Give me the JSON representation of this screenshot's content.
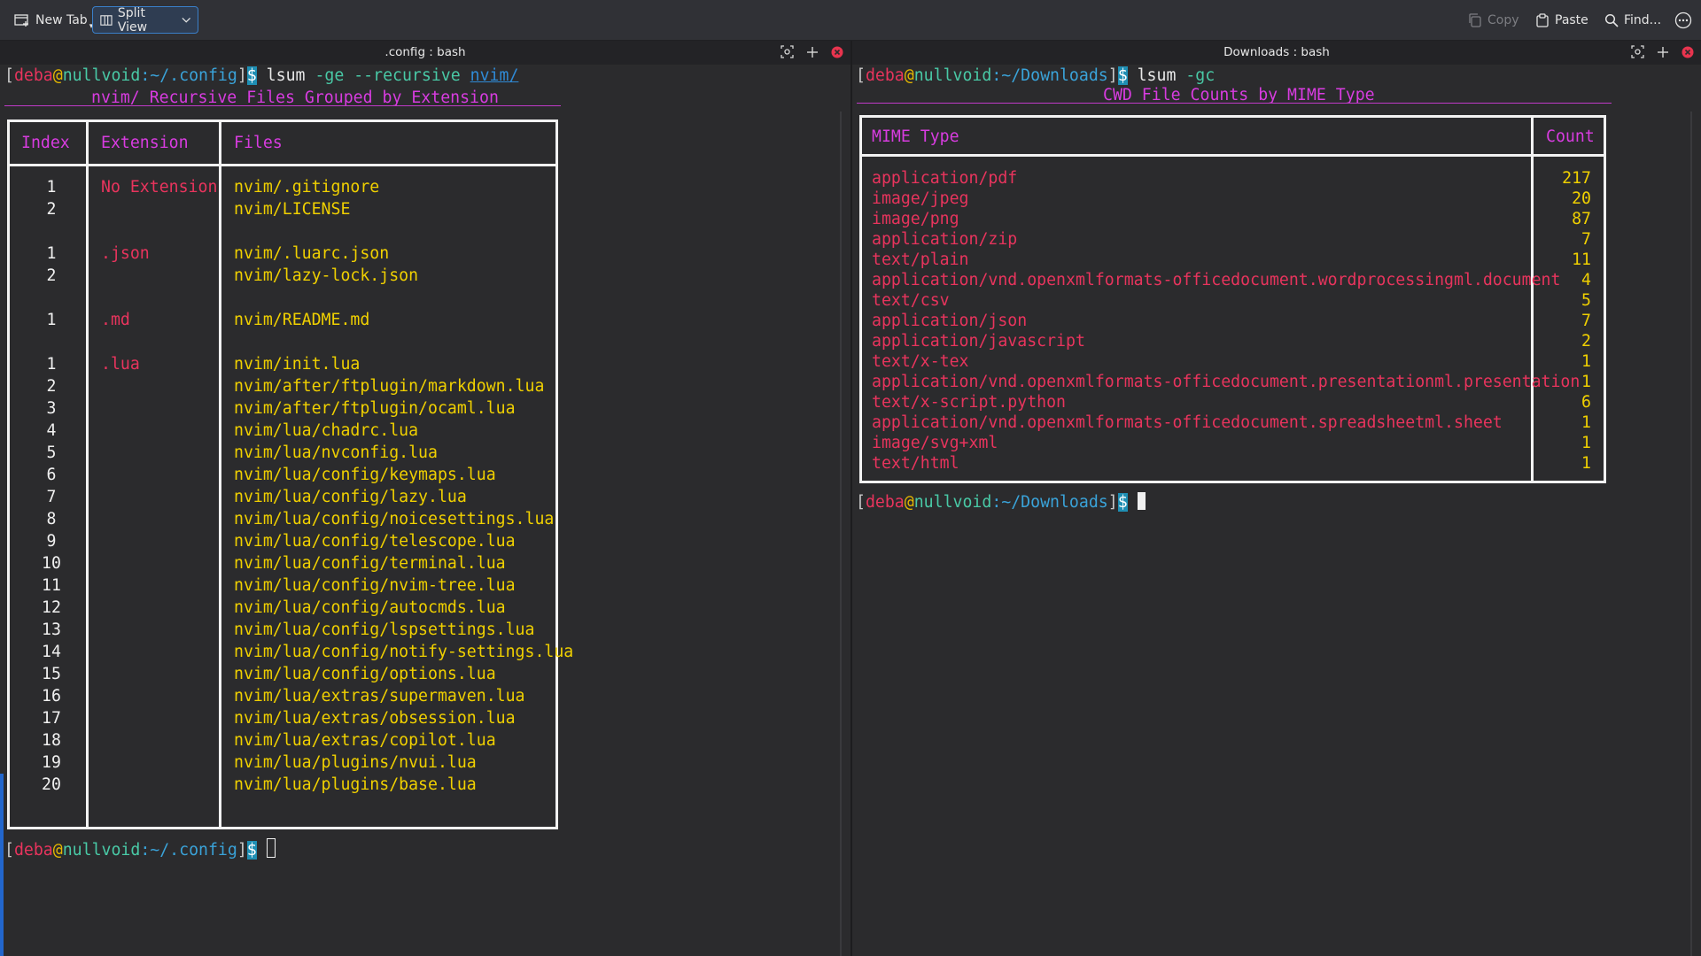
{
  "toolbar": {
    "new_tab": "New Tab",
    "split_view": "Split View",
    "copy": "Copy",
    "paste": "Paste",
    "find": "Find..."
  },
  "left": {
    "title": ".config : bash",
    "prompt": {
      "user": "deba",
      "at": "@",
      "host": "nullvoid",
      "path": ":~/.config",
      "dollar": "$"
    },
    "command": {
      "cmd": " lsum ",
      "flags": "-ge --recursive ",
      "arg": "nvim/"
    },
    "table_title": "nvim/ Recursive Files Grouped by Extension",
    "headers": {
      "index": "Index",
      "extension": "Extension",
      "files": "Files"
    },
    "rows": [
      {
        "index": "1",
        "ext": "No Extension",
        "file": "nvim/.gitignore"
      },
      {
        "index": "2",
        "ext": "",
        "file": "nvim/LICENSE"
      },
      {
        "index": "1",
        "ext": ".json",
        "file": "nvim/.luarc.json"
      },
      {
        "index": "2",
        "ext": "",
        "file": "nvim/lazy-lock.json"
      },
      {
        "index": "1",
        "ext": ".md",
        "file": "nvim/README.md"
      },
      {
        "index": "1",
        "ext": ".lua",
        "file": "nvim/init.lua"
      },
      {
        "index": "2",
        "ext": "",
        "file": "nvim/after/ftplugin/markdown.lua"
      },
      {
        "index": "3",
        "ext": "",
        "file": "nvim/after/ftplugin/ocaml.lua"
      },
      {
        "index": "4",
        "ext": "",
        "file": "nvim/lua/chadrc.lua"
      },
      {
        "index": "5",
        "ext": "",
        "file": "nvim/lua/nvconfig.lua"
      },
      {
        "index": "6",
        "ext": "",
        "file": "nvim/lua/config/keymaps.lua"
      },
      {
        "index": "7",
        "ext": "",
        "file": "nvim/lua/config/lazy.lua"
      },
      {
        "index": "8",
        "ext": "",
        "file": "nvim/lua/config/noicesettings.lua"
      },
      {
        "index": "9",
        "ext": "",
        "file": "nvim/lua/config/telescope.lua"
      },
      {
        "index": "10",
        "ext": "",
        "file": "nvim/lua/config/terminal.lua"
      },
      {
        "index": "11",
        "ext": "",
        "file": "nvim/lua/config/nvim-tree.lua"
      },
      {
        "index": "12",
        "ext": "",
        "file": "nvim/lua/config/autocmds.lua"
      },
      {
        "index": "13",
        "ext": "",
        "file": "nvim/lua/config/lspsettings.lua"
      },
      {
        "index": "14",
        "ext": "",
        "file": "nvim/lua/config/notify-settings.lua"
      },
      {
        "index": "15",
        "ext": "",
        "file": "nvim/lua/config/options.lua"
      },
      {
        "index": "16",
        "ext": "",
        "file": "nvim/lua/extras/supermaven.lua"
      },
      {
        "index": "17",
        "ext": "",
        "file": "nvim/lua/extras/obsession.lua"
      },
      {
        "index": "18",
        "ext": "",
        "file": "nvim/lua/extras/copilot.lua"
      },
      {
        "index": "19",
        "ext": "",
        "file": "nvim/lua/plugins/nvui.lua"
      },
      {
        "index": "20",
        "ext": "",
        "file": "nvim/lua/plugins/base.lua"
      }
    ]
  },
  "right": {
    "title": "Downloads : bash",
    "prompt": {
      "user": "deba",
      "at": "@",
      "host": "nullvoid",
      "path": ":~/Downloads",
      "dollar": "$"
    },
    "command": {
      "cmd": " lsum ",
      "flags": "-gc"
    },
    "table_title": "CWD File Counts by MIME Type",
    "headers": {
      "mime": "MIME Type",
      "count": "Count"
    },
    "rows": [
      {
        "mime": "application/pdf",
        "count": "217"
      },
      {
        "mime": "image/jpeg",
        "count": "20"
      },
      {
        "mime": "image/png",
        "count": "87"
      },
      {
        "mime": "application/zip",
        "count": "7"
      },
      {
        "mime": "text/plain",
        "count": "11"
      },
      {
        "mime": "application/vnd.openxmlformats-officedocument.wordprocessingml.document",
        "count": "4"
      },
      {
        "mime": "text/csv",
        "count": "5"
      },
      {
        "mime": "application/json",
        "count": "7"
      },
      {
        "mime": "application/javascript",
        "count": "2"
      },
      {
        "mime": "text/x-tex",
        "count": "1"
      },
      {
        "mime": "application/vnd.openxmlformats-officedocument.presentationml.presentation",
        "count": "1"
      },
      {
        "mime": "text/x-script.python",
        "count": "6"
      },
      {
        "mime": "application/vnd.openxmlformats-officedocument.spreadsheetml.sheet",
        "count": "1"
      },
      {
        "mime": "image/svg+xml",
        "count": "1"
      },
      {
        "mime": "text/html",
        "count": "1"
      }
    ]
  }
}
